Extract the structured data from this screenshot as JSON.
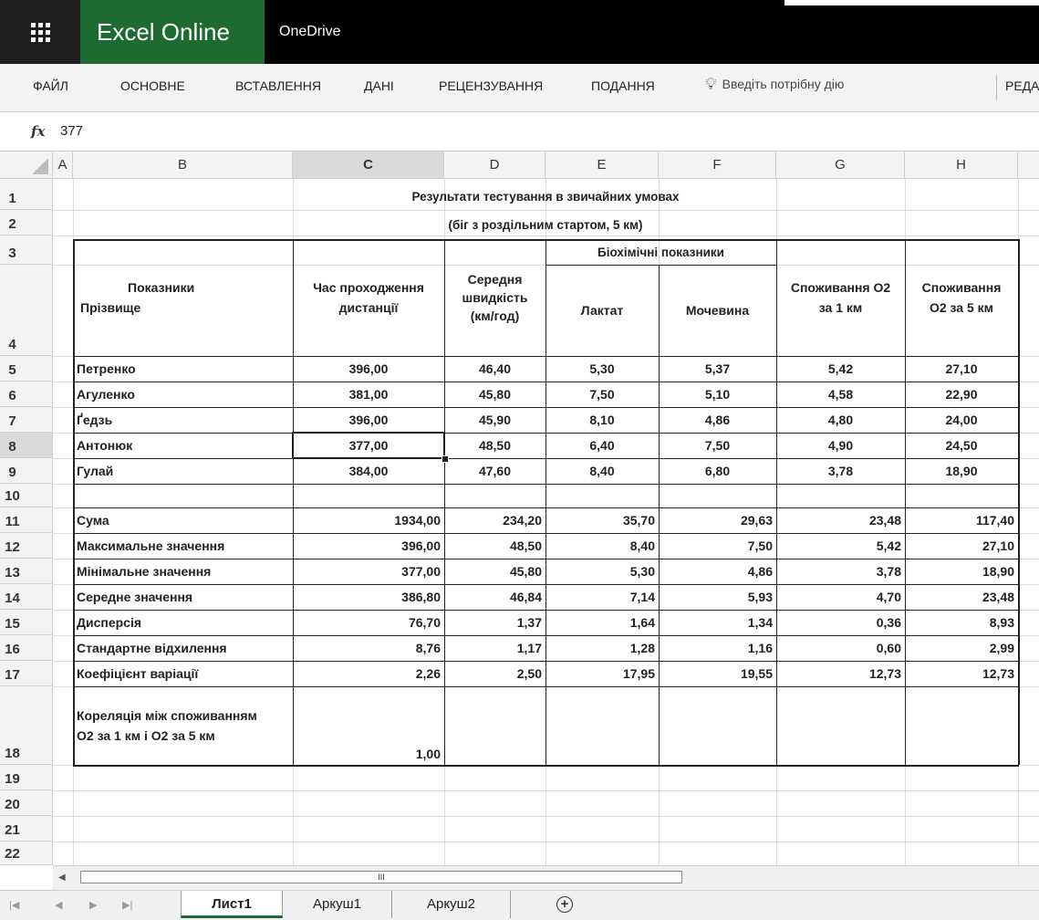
{
  "titlebar": {
    "app_name": "Excel Online",
    "location": "OneDrive",
    "app_launcher_icon": "waffle-icon"
  },
  "ribbon": {
    "tabs": [
      "ФАЙЛ",
      "ОСНОВНЕ",
      "ВСТАВЛЕННЯ",
      "ДАНІ",
      "РЕЦЕНЗУВАННЯ",
      "ПОДАННЯ"
    ],
    "tell_me": "Введіть потрібну дію",
    "tell_me_icon": "lightbulb-icon",
    "edit_label": "РЕДАГУ"
  },
  "formula_bar": {
    "fx_label": "fx",
    "value": "377"
  },
  "columns": [
    "A",
    "B",
    "C",
    "D",
    "E",
    "F",
    "G",
    "H"
  ],
  "selected_column": "C",
  "rows": [
    "1",
    "2",
    "3",
    "4",
    "5",
    "6",
    "7",
    "8",
    "9",
    "10",
    "11",
    "12",
    "13",
    "14",
    "15",
    "16",
    "17",
    "18",
    "19",
    "20",
    "21",
    "22"
  ],
  "selected_row": "8",
  "sheet": {
    "title1": "Результати тестування в звичайних умовах",
    "title2": "(біг з роздільним стартом, 5 км)",
    "header": {
      "indicators": "Показники",
      "surname": "Прізвище",
      "time_1": "Час проходження",
      "time_2": "дистанції",
      "speed_1": "Середня",
      "speed_2": "швидкість",
      "speed_3": "(км/год)",
      "biochem": "Біохімічні показники",
      "lactate": "Лактат",
      "urea": "Мочевина",
      "o2_1km_1": "Споживання О2",
      "o2_1km_2": "за 1 км",
      "o2_5km_1": "Споживання",
      "o2_5km_2": "О2 за 5 км"
    },
    "athletes": [
      {
        "name": "Петренко",
        "time": "396,00",
        "speed": "46,40",
        "lactate": "5,30",
        "urea": "5,37",
        "o2_1": "5,42",
        "o2_5": "27,10"
      },
      {
        "name": "Агуленко",
        "time": "381,00",
        "speed": "45,80",
        "lactate": "7,50",
        "urea": "5,10",
        "o2_1": "4,58",
        "o2_5": "22,90"
      },
      {
        "name": "Ґедзь",
        "time": "396,00",
        "speed": "45,90",
        "lactate": "8,10",
        "urea": "4,86",
        "o2_1": "4,80",
        "o2_5": "24,00"
      },
      {
        "name": "Антонюк",
        "time": "377,00",
        "speed": "48,50",
        "lactate": "6,40",
        "urea": "7,50",
        "o2_1": "4,90",
        "o2_5": "24,50"
      },
      {
        "name": "Гулай",
        "time": "384,00",
        "speed": "47,60",
        "lactate": "8,40",
        "urea": "6,80",
        "o2_1": "3,78",
        "o2_5": "18,90"
      }
    ],
    "stats": [
      {
        "label": "Сума",
        "c": "1934,00",
        "d": "234,20",
        "e": "35,70",
        "f": "29,63",
        "g": "23,48",
        "h": "117,40"
      },
      {
        "label": "Максимальне значення",
        "c": "396,00",
        "d": "48,50",
        "e": "8,40",
        "f": "7,50",
        "g": "5,42",
        "h": "27,10"
      },
      {
        "label": "Мінімальне значення",
        "c": "377,00",
        "d": "45,80",
        "e": "5,30",
        "f": "4,86",
        "g": "3,78",
        "h": "18,90"
      },
      {
        "label": "Середне значення",
        "c": "386,80",
        "d": "46,84",
        "e": "7,14",
        "f": "5,93",
        "g": "4,70",
        "h": "23,48"
      },
      {
        "label": "Дисперсія",
        "c": "76,70",
        "d": "1,37",
        "e": "1,64",
        "f": "1,34",
        "g": "0,36",
        "h": "8,93"
      },
      {
        "label": "Стандартне відхилення",
        "c": "8,76",
        "d": "1,17",
        "e": "1,28",
        "f": "1,16",
        "g": "0,60",
        "h": "2,99"
      },
      {
        "label": "Коефіцієнт варіації",
        "c": "2,26",
        "d": "2,50",
        "e": "17,95",
        "f": "19,55",
        "g": "12,73",
        "h": "12,73"
      }
    ],
    "correlation": {
      "label_1": "Кореляція між споживанням",
      "label_2": "О2 за 1 км і О2 за 5 км",
      "value": "1,00"
    }
  },
  "scrollbar": {
    "thumb_label": "III"
  },
  "sheet_tabs": [
    "Лист1",
    "Аркуш1",
    "Аркуш2"
  ],
  "active_sheet": "Лист1",
  "colors": {
    "brand_green": "#1e6b31",
    "titlebar": "#000000",
    "ribbon_bg": "#f3f3f3"
  }
}
